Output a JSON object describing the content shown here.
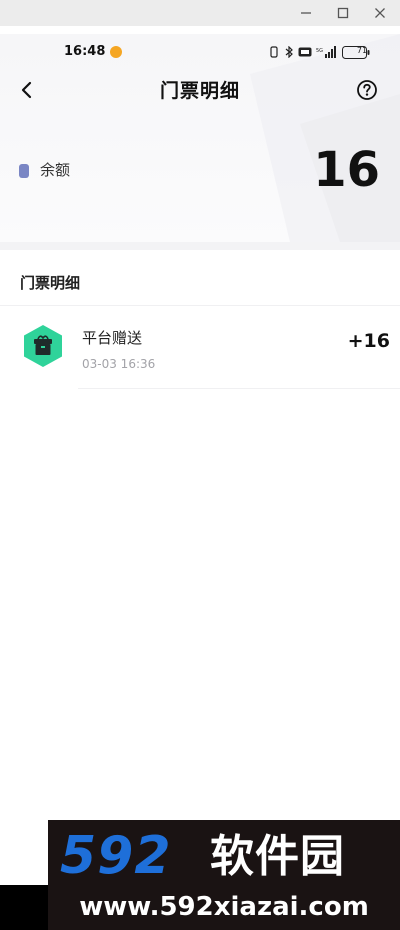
{
  "status_bar": {
    "time": "16:48",
    "battery": "71"
  },
  "nav": {
    "title": "门票明细"
  },
  "balance": {
    "label": "余额",
    "value": "16"
  },
  "section": {
    "title": "门票明细"
  },
  "records": [
    {
      "title": "平台赠送",
      "time": "03-03 16:36",
      "amount": "+16"
    }
  ],
  "watermark": {
    "number": "592",
    "name": "软件园",
    "url": "www.592xiazai.com"
  },
  "colors": {
    "accent_green": "#2fd39a",
    "watermark_blue": "#1e6fd9",
    "status_dot": "#f5a623"
  },
  "icons": [
    "back-arrow-icon",
    "help-icon",
    "ticket-icon",
    "gift-box-icon",
    "minimize-icon",
    "maximize-icon",
    "close-icon",
    "bluetooth-icon",
    "signal-icon",
    "battery-icon"
  ]
}
